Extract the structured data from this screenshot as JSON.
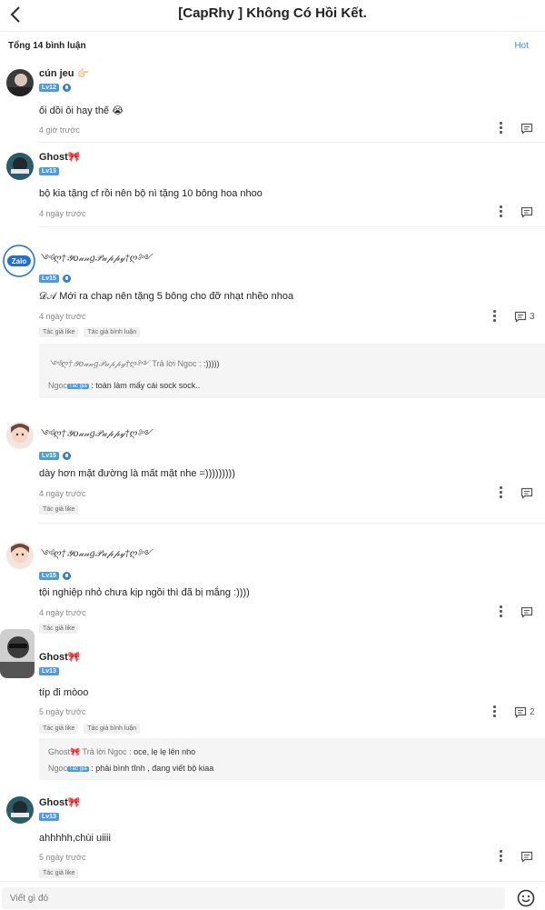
{
  "header": {
    "title": "[CapRhy ] Không Có Hồi Kết."
  },
  "summary": {
    "count_label": "Tổng 14 bình luận",
    "sort_label": "Hot"
  },
  "comments": [
    {
      "name": "cún jeu 👉🏻",
      "level": "Lv12",
      "text": "ối dồi ôi hay thế 😭",
      "time": "4 giờ trước"
    },
    {
      "name": "Ghost🎀",
      "level": "Lv13",
      "text": "bộ kia tặng cf rồi nên bộ nì tặng 10 bông hoa nhoo",
      "time": "4 ngày trước"
    },
    {
      "name": "༺ღ†𝒴𝑜𝓊𝓃𝑔𝒫𝓊𝓅𝓅𝓎†ღ༻",
      "level": "Lv15",
      "text": "𝒟𝒜 Mới ra chap nên tặng 5 bông cho đỡ nhạt nhẽo nhoa",
      "time": "4 ngày trước",
      "reply_count": "3",
      "tags": [
        "Tác giả like",
        "Tác giả bình luận"
      ],
      "replies": [
        {
          "who": "༺ღ†𝒴𝑜𝓊𝓃𝑔𝒫𝓊𝓅𝓅𝓎†ღ༻",
          "verb": " Trả lời Ngoc : ",
          "text": ":)))))"
        },
        {
          "who": "Ngoc",
          "badge": "Tác giả",
          "verb": " : ",
          "text": "toàn làm mấy cái sock sock.."
        }
      ]
    },
    {
      "name": "༺ღ†𝒴𝑜𝓊𝓃𝑔𝒫𝓊𝓅𝓅𝓎†ღ༻",
      "level": "Lv15",
      "text": "dày hơn mặt đường là mất mặt nhe =)))))))))",
      "time": "4 ngày trước",
      "tags": [
        "Tác giả like"
      ]
    },
    {
      "name": "༺ღ†𝒴𝑜𝓊𝓃𝑔𝒫𝓊𝓅𝓅𝓎†ღ༻",
      "level": "Lv15",
      "text": "tội nghiệp nhỏ chưa kịp ngồi thì đã bị mắng :))))",
      "time": "4 ngày trước",
      "tags": [
        "Tác giả like"
      ]
    },
    {
      "name": "Ghost🎀",
      "level": "Lv13",
      "text": "típ đi mòoo",
      "time": "5 ngày trước",
      "reply_count": "2",
      "tags": [
        "Tác giả like",
        "Tác giả bình luận"
      ],
      "replies": [
        {
          "who": "Ghost🎀",
          "verb": " Trả lời Ngoc : ",
          "text": "oce, lẹ lẹ lên nho"
        },
        {
          "who": "Ngoc",
          "badge": "Tác giả",
          "verb": " : ",
          "text": "phải bình tĩnh , đang viết bộ kiaa"
        }
      ]
    },
    {
      "name": "Ghost🎀",
      "level": "Lv13",
      "text": "ahhhhh,chùi uiiii",
      "time": "5 ngày trước",
      "tags": [
        "Tác giả like"
      ]
    }
  ],
  "composer": {
    "placeholder": "Viết gì đó"
  },
  "icons": {
    "back": "chevron-left-icon",
    "more": "more-vertical-icon",
    "reply": "comment-icon",
    "emoji": "smiley-icon",
    "verified": "shield-icon"
  },
  "colors": {
    "accent": "#3b8fdc",
    "level_badge": "#4a9be0"
  }
}
